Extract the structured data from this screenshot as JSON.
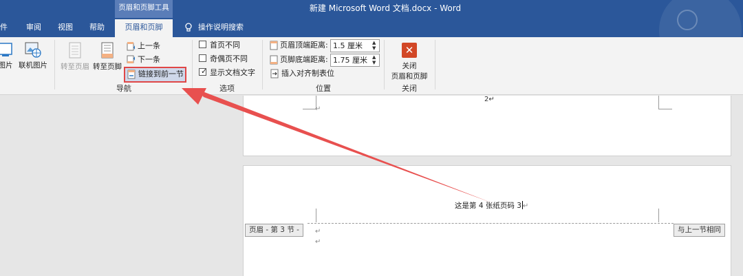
{
  "titlebar": {
    "context_group": "页眉和页脚工具",
    "doc_title": "新建 Microsoft Word 文档.docx  -  Word"
  },
  "tabs": {
    "mail": "件",
    "review": "审阅",
    "view": "视图",
    "help": "帮助",
    "header_footer": "页眉和页脚",
    "tell_me": "操作说明搜索"
  },
  "ribbon": {
    "insert": {
      "picture_partial": "图片",
      "online_picture": "联机图片"
    },
    "nav": {
      "goto_header": "转至页眉",
      "goto_footer": "转至页脚",
      "previous": "上一条",
      "next": "下一条",
      "link_previous": "链接到前一节",
      "label": "导航"
    },
    "options": {
      "different_first": "首页不同",
      "different_odd_even": "奇偶页不同",
      "show_doc_text": "显示文档文字",
      "label": "选项",
      "show_doc_text_checked": true
    },
    "position": {
      "header_top_label": "页眉顶端距离:",
      "header_top_value": "1.5 厘米",
      "footer_bottom_label": "页脚底端距离:",
      "footer_bottom_value": "1.75 厘米",
      "insert_align_tab": "插入对齐制表位",
      "label": "位置"
    },
    "close": {
      "line1": "关闭",
      "line2": "页眉和页脚",
      "label": "关闭"
    }
  },
  "document": {
    "page_number": "2",
    "para_mark": "↵",
    "header_text": "这是第 4 张纸页码 3",
    "header_tag": "页眉 - 第 3 节 -",
    "same_as_previous": "与上一节相同"
  },
  "colors": {
    "titlebar": "#2b579a",
    "highlight_box": "#e04646",
    "annotation_arrow": "#e8504f"
  }
}
